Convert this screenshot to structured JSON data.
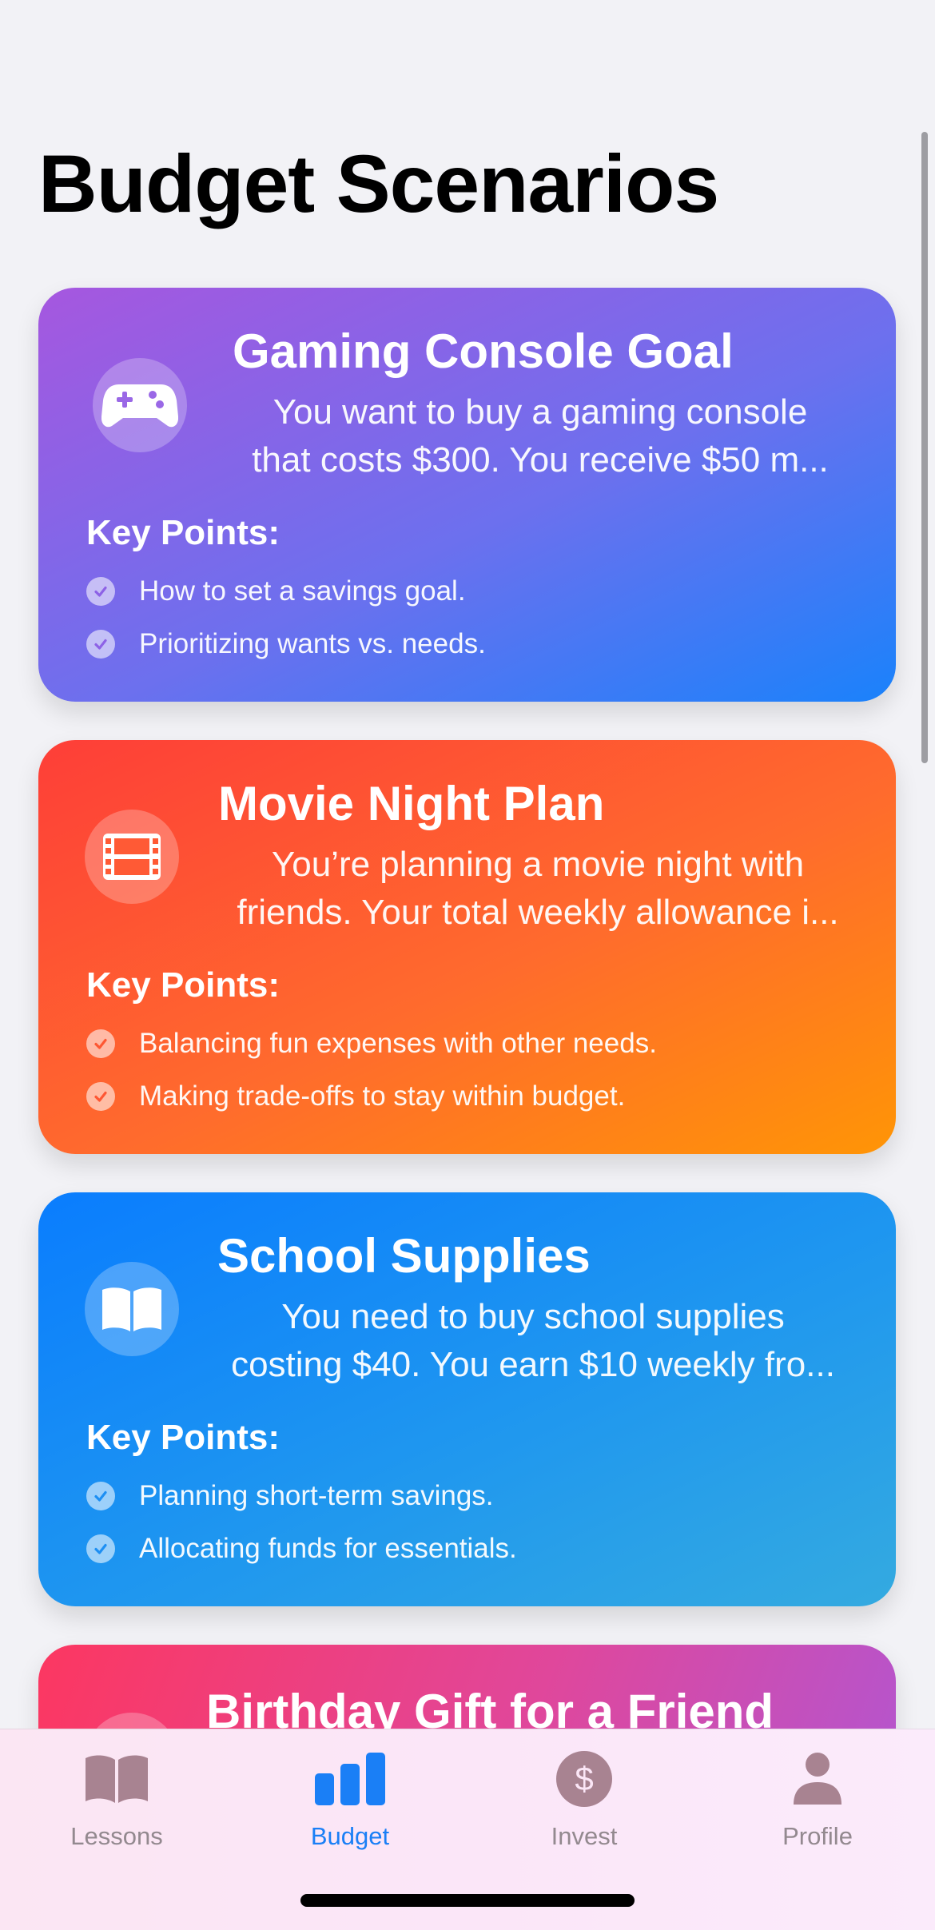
{
  "page": {
    "title": "Budget Scenarios"
  },
  "cards": [
    {
      "title": "Gaming Console Goal",
      "desc_line1": "You want to buy a gaming console",
      "desc_line2": "that costs $300. You receive $50 m...",
      "key_points_label": "Key Points:",
      "points": [
        "How to set a savings goal.",
        "Prioritizing wants vs. needs."
      ],
      "icon": "gamecontroller-icon",
      "check_color": "#8f62e6"
    },
    {
      "title": "Movie Night Plan",
      "desc_line1": "You’re planning a movie night with",
      "desc_line2": "friends. Your total weekly allowance i...",
      "key_points_label": "Key Points:",
      "points": [
        "Balancing fun expenses with other needs.",
        "Making trade-offs to stay within budget."
      ],
      "icon": "film-icon",
      "check_color": "#fe5734"
    },
    {
      "title": "School Supplies",
      "desc_line1": "You need to buy school supplies",
      "desc_line2": "costing $40. You earn $10 weekly fro...",
      "key_points_label": "Key Points:",
      "points": [
        "Planning short-term savings.",
        "Allocating funds for essentials."
      ],
      "icon": "book-icon",
      "check_color": "#1e8ff4"
    },
    {
      "title": "Birthday Gift for a Friend",
      "icon": "gift-icon"
    }
  ],
  "tabs": [
    {
      "label": "Lessons",
      "icon": "book-icon",
      "active": false
    },
    {
      "label": "Budget",
      "icon": "chart-bar-icon",
      "active": true
    },
    {
      "label": "Invest",
      "icon": "dollar-circle-icon",
      "active": false
    },
    {
      "label": "Profile",
      "icon": "person-icon",
      "active": false
    }
  ],
  "colors": {
    "accent": "#1a7ff6",
    "inactive_tab": "#93898f"
  }
}
